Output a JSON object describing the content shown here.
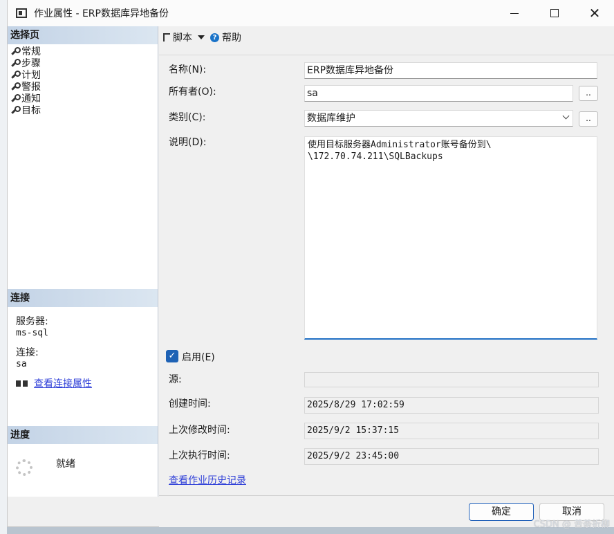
{
  "window": {
    "title": "作业属性 - ERP数据库异地备份"
  },
  "left": {
    "pages_header": "选择页",
    "pages": [
      "常规",
      "步骤",
      "计划",
      "警报",
      "通知",
      "目标"
    ],
    "connection_header": "连接",
    "server_label": "服务器:",
    "server_value": "ms-sql",
    "connection_label": "连接:",
    "connection_value": "sa",
    "view_conn_props": "查看连接属性",
    "progress_header": "进度",
    "progress_status": "就绪"
  },
  "toolbar": {
    "script_label": "脚本",
    "help_label": "帮助"
  },
  "form": {
    "name_label": "名称(N):",
    "name_value": "ERP数据库异地备份",
    "owner_label": "所有者(O):",
    "owner_value": "sa",
    "owner_btn": "..",
    "category_label": "类别(C):",
    "category_value": "数据库维护",
    "category_btn": "..",
    "desc_label": "说明(D):",
    "desc_value": "使用目标服务器Administrator账号备份到\\\n\\172.70.74.211\\SQLBackups",
    "enabled_label": "启用(E)",
    "enabled": true,
    "source_label": "源:",
    "source_value": "",
    "created_label": "创建时间:",
    "created_value": "2025/8/29 17:02:59",
    "modified_label": "上次修改时间:",
    "modified_value": "2025/9/2 15:37:15",
    "executed_label": "上次执行时间:",
    "executed_value": "2025/9/2 23:45:00",
    "history_link": "查看作业历史记录"
  },
  "footer": {
    "ok_label": "确定",
    "cancel_label": "取消"
  },
  "watermark": "CSDN @ 苦荼折柳",
  "colors": {
    "accent": "#1e62b5",
    "section_header": "#c9d8e8",
    "link": "#2f3fd8"
  }
}
